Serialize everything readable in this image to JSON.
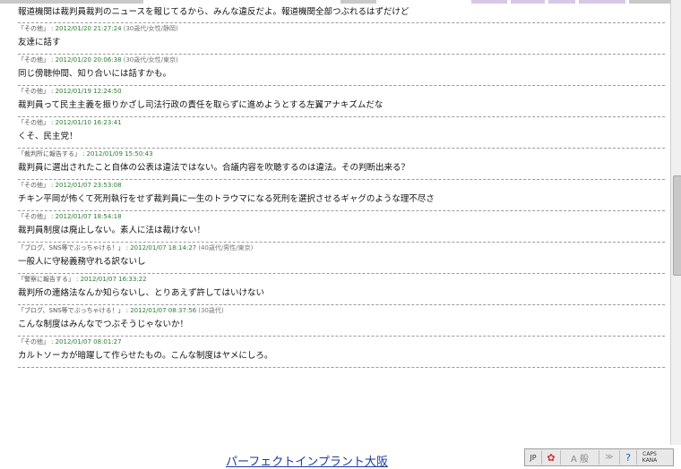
{
  "colors": {
    "topbar": [
      "#c9c9c9",
      "#c9c9c9",
      "#d8c8e8",
      "#d8c8e8",
      "#d8c8e8",
      "#d8c8e8",
      "#c9c9c9"
    ],
    "timestamp": "#2e7d32",
    "link": "#1a3a9c"
  },
  "comments": [
    {
      "category": "",
      "timestamp": "",
      "demographic": "",
      "text": "報道機関は裁判員裁判のニュースを報じてるから、みんな違反だよ。報道機関全部つぶれるはずだけど"
    },
    {
      "category": "「その他」",
      "timestamp": ": 2012/01/20 21:27:24",
      "demographic": "(30歳代/女性/静岡)",
      "text": "友達に話す"
    },
    {
      "category": "「その他」",
      "timestamp": ": 2012/01/20 20:06:38",
      "demographic": "(30歳代/女性/東京)",
      "text": "同じ傍聴仲間、知り合いには話すかも。"
    },
    {
      "category": "「その他」",
      "timestamp": ": 2012/01/19 12:24:50",
      "demographic": "",
      "text": "裁判員って民主主義を振りかざし司法行政の責任を取らずに進めようとする左翼アナキズムだな"
    },
    {
      "category": "「その他」",
      "timestamp": ": 2012/01/10 16:23:41",
      "demographic": "",
      "text": "くそ、民主党！"
    },
    {
      "category": "「裁判所に報告する」",
      "timestamp": ": 2012/01/09 15:50:43",
      "demographic": "",
      "text": "裁判員に選出されたこと自体の公表は違法ではない。合議内容を吹聴するのは違法。その判断出来る？"
    },
    {
      "category": "「その他」",
      "timestamp": ": 2012/01/07 23:53:08",
      "demographic": "",
      "text": "チキン平岡が怖くて死刑執行をせず裁判員に一生のトラウマになる死刑を選択させるギャグのような理不尽さ"
    },
    {
      "category": "「その他」",
      "timestamp": ": 2012/01/07 18:54:18",
      "demographic": "",
      "text": "裁判員制度は廃止しない。素人に法は裁けない！"
    },
    {
      "category": "「ブログ、SNS等でぶっちゃける！」",
      "timestamp": ": 2012/01/07 18:14:27",
      "demographic": "(40歳代/男性/東京)",
      "text": "一般人に守秘義務守れる訳ないし"
    },
    {
      "category": "「警察に報告する」",
      "timestamp": ": 2012/01/07 16:33:22",
      "demographic": "",
      "text": "裁判所の連絡法なんか知らないし、とりあえず許してはいけない"
    },
    {
      "category": "「ブログ、SNS等でぶっちゃける！」",
      "timestamp": ": 2012/01/07 08:37:56",
      "demographic": "(30歳代)",
      "text": "こんな制度はみんなでつぶそうじゃないか！"
    },
    {
      "category": "「その他」",
      "timestamp": ": 2012/01/07 08:01:27",
      "demographic": "",
      "text": "カルトソーカが暗躍して作らせたもの。こんな制度はヤメにしろ。"
    }
  ],
  "bottom_link": "パーフェクトインプラント大阪",
  "ime": {
    "lang": "JP",
    "mode_icon": "ime-mode-icon",
    "mode": "A 般",
    "options": "≫",
    "help": "?",
    "caps": "CAPS",
    "kana": "KANA"
  }
}
